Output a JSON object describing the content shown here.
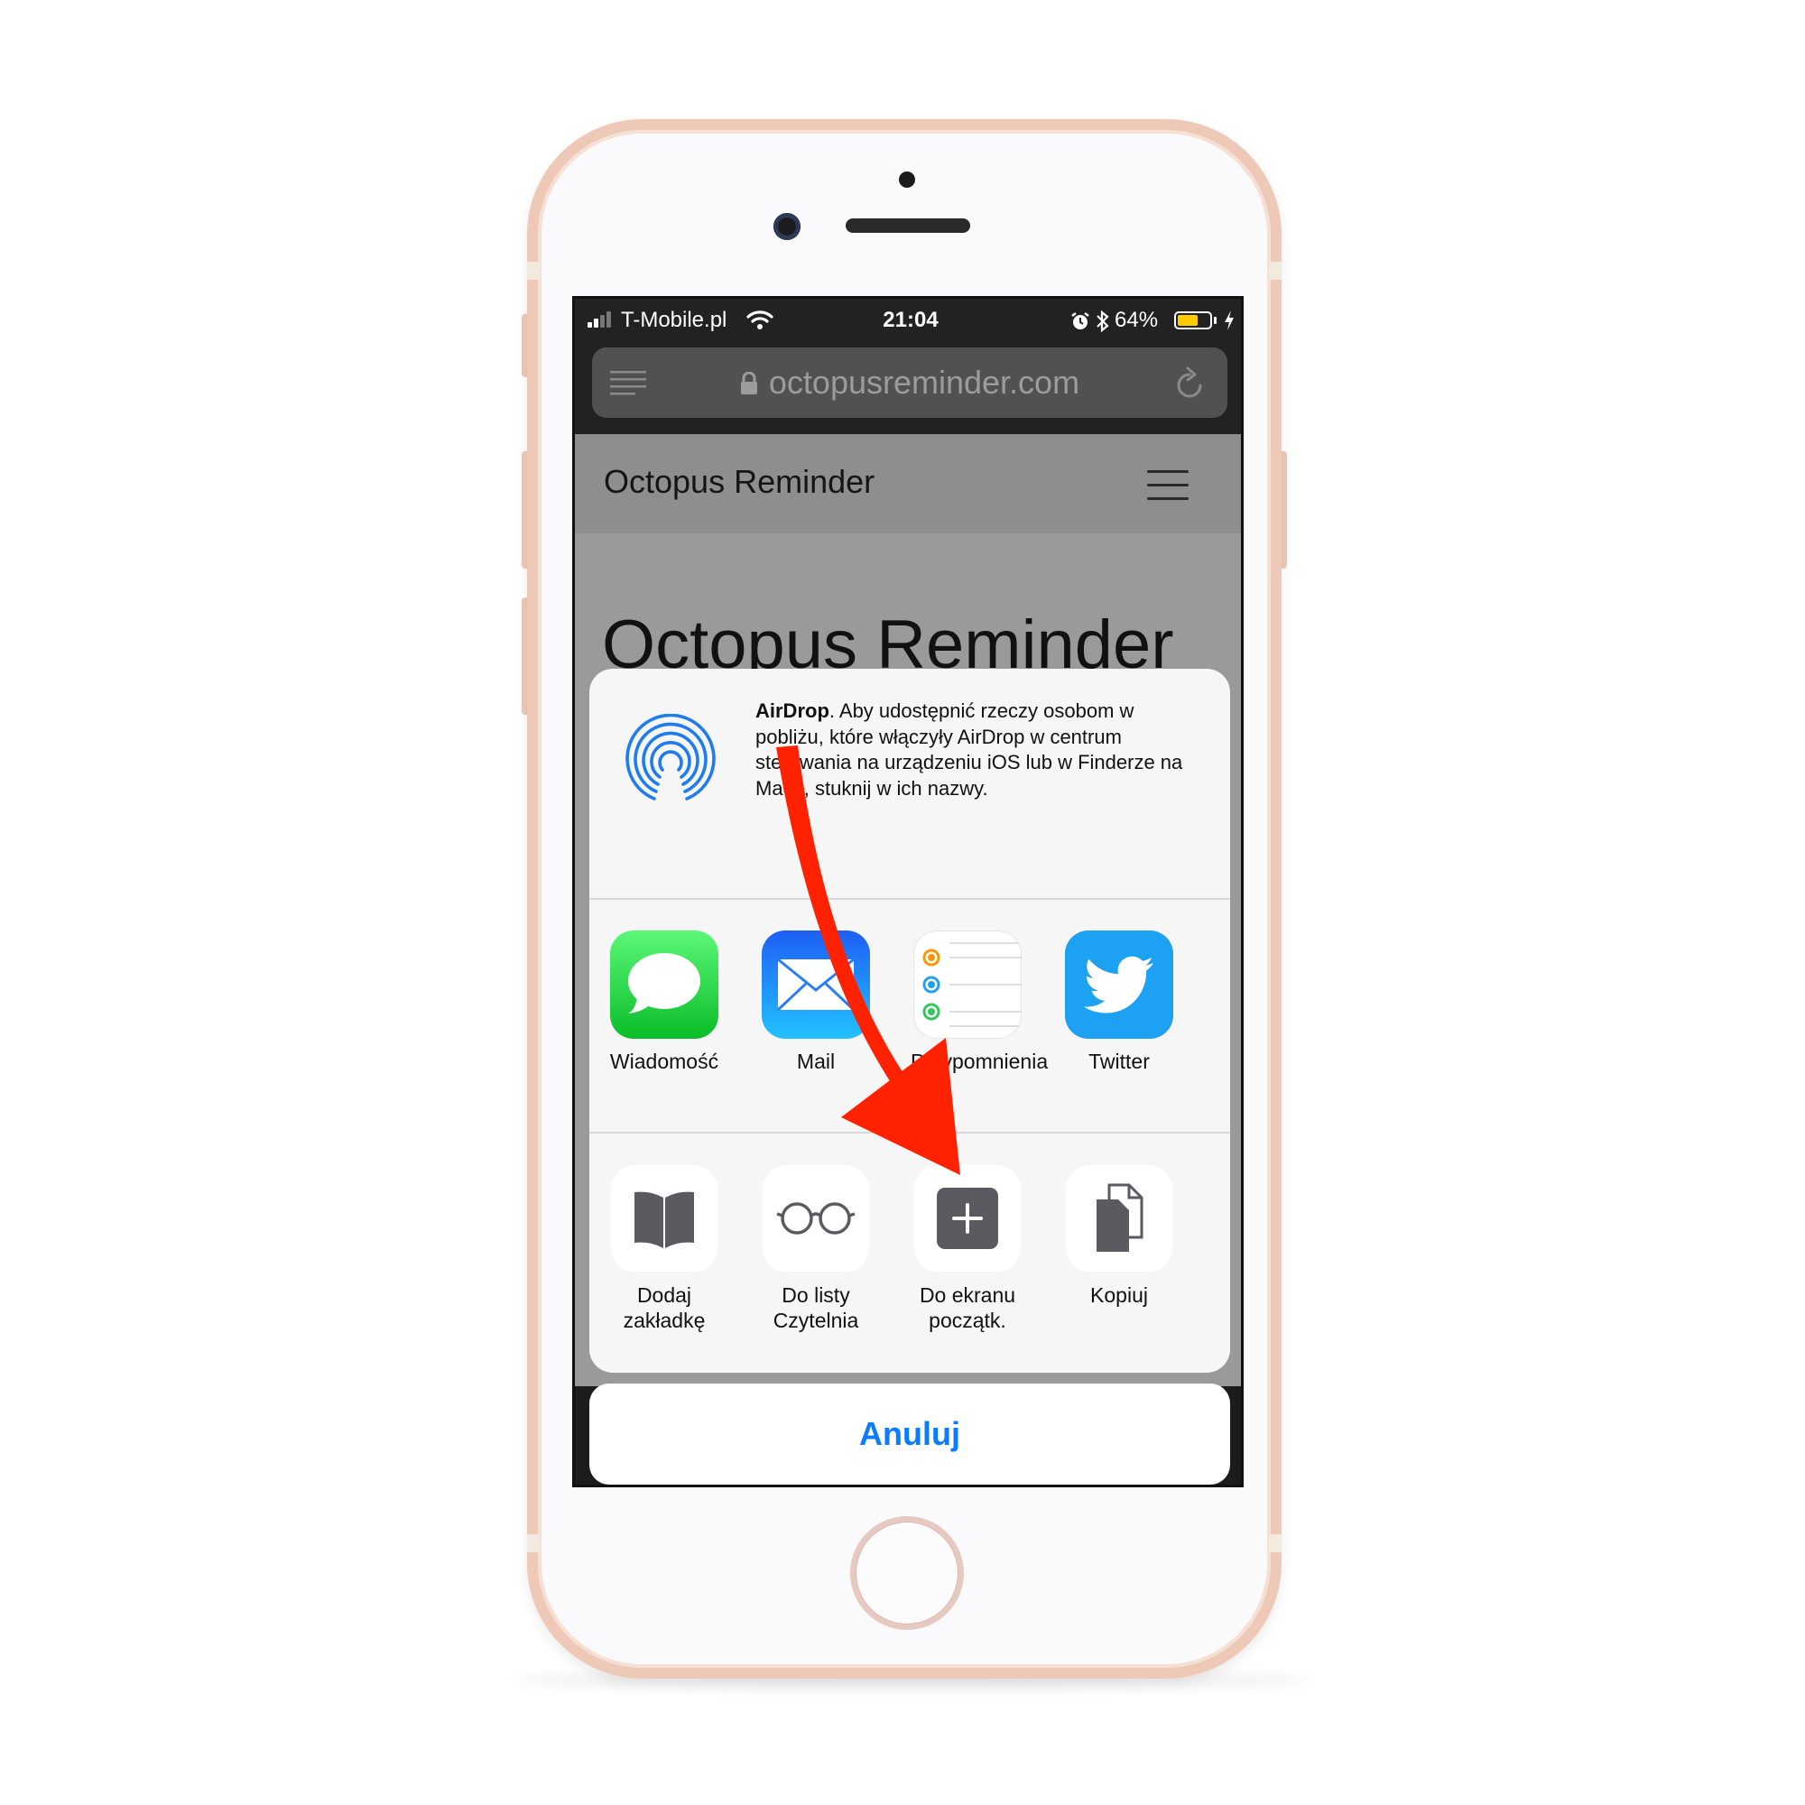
{
  "status_bar": {
    "carrier": "T-Mobile.pl",
    "time": "21:04",
    "battery": "64%",
    "battery_level": 0.64
  },
  "browser": {
    "url": "octopusreminder.com"
  },
  "webpage": {
    "nav_title": "Octopus Reminder",
    "hero_title": "Octopus Reminder"
  },
  "share_sheet": {
    "airdrop": {
      "title": "AirDrop",
      "description": ". Aby udostępnić rzeczy osobom w pobliżu, które włączyły AirDrop w centrum sterowania na urządzeniu iOS lub w Finderze na Macu, stuknij w ich nazwy."
    },
    "apps": [
      {
        "label": "Wiadomość",
        "icon": "messages-icon"
      },
      {
        "label": "Mail",
        "icon": "mail-icon"
      },
      {
        "label": "Przypomnienia",
        "icon": "reminders-icon"
      },
      {
        "label": "Twitter",
        "icon": "twitter-icon"
      }
    ],
    "actions": [
      {
        "label": "Dodaj zakładkę",
        "icon": "bookmark-book-icon"
      },
      {
        "label": "Do listy Czytelnia",
        "icon": "glasses-icon"
      },
      {
        "label": "Do ekranu początk.",
        "icon": "add-square-icon"
      },
      {
        "label": "Kopiuj",
        "icon": "copy-icon"
      }
    ],
    "cancel": "Anuluj"
  },
  "colors": {
    "phone_frame": "#efc9b7",
    "accent_blue": "#0a7cff",
    "annotation_arrow": "#ff2200",
    "battery_fill": "#ffcc00"
  }
}
